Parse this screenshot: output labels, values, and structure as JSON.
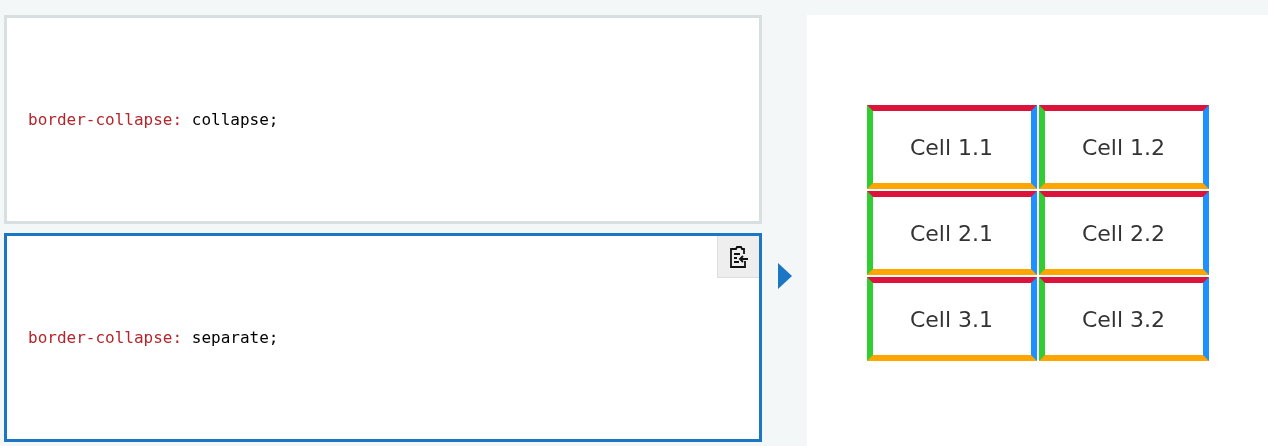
{
  "choices": [
    {
      "property": "border-collapse:",
      "value": "collapse;",
      "selected": false
    },
    {
      "property": "border-collapse:",
      "value": "separate;",
      "selected": true
    }
  ],
  "output": {
    "table": {
      "rows": [
        [
          "Cell 1.1",
          "Cell 1.2"
        ],
        [
          "Cell 2.1",
          "Cell 2.2"
        ],
        [
          "Cell 3.1",
          "Cell 3.2"
        ]
      ]
    }
  }
}
